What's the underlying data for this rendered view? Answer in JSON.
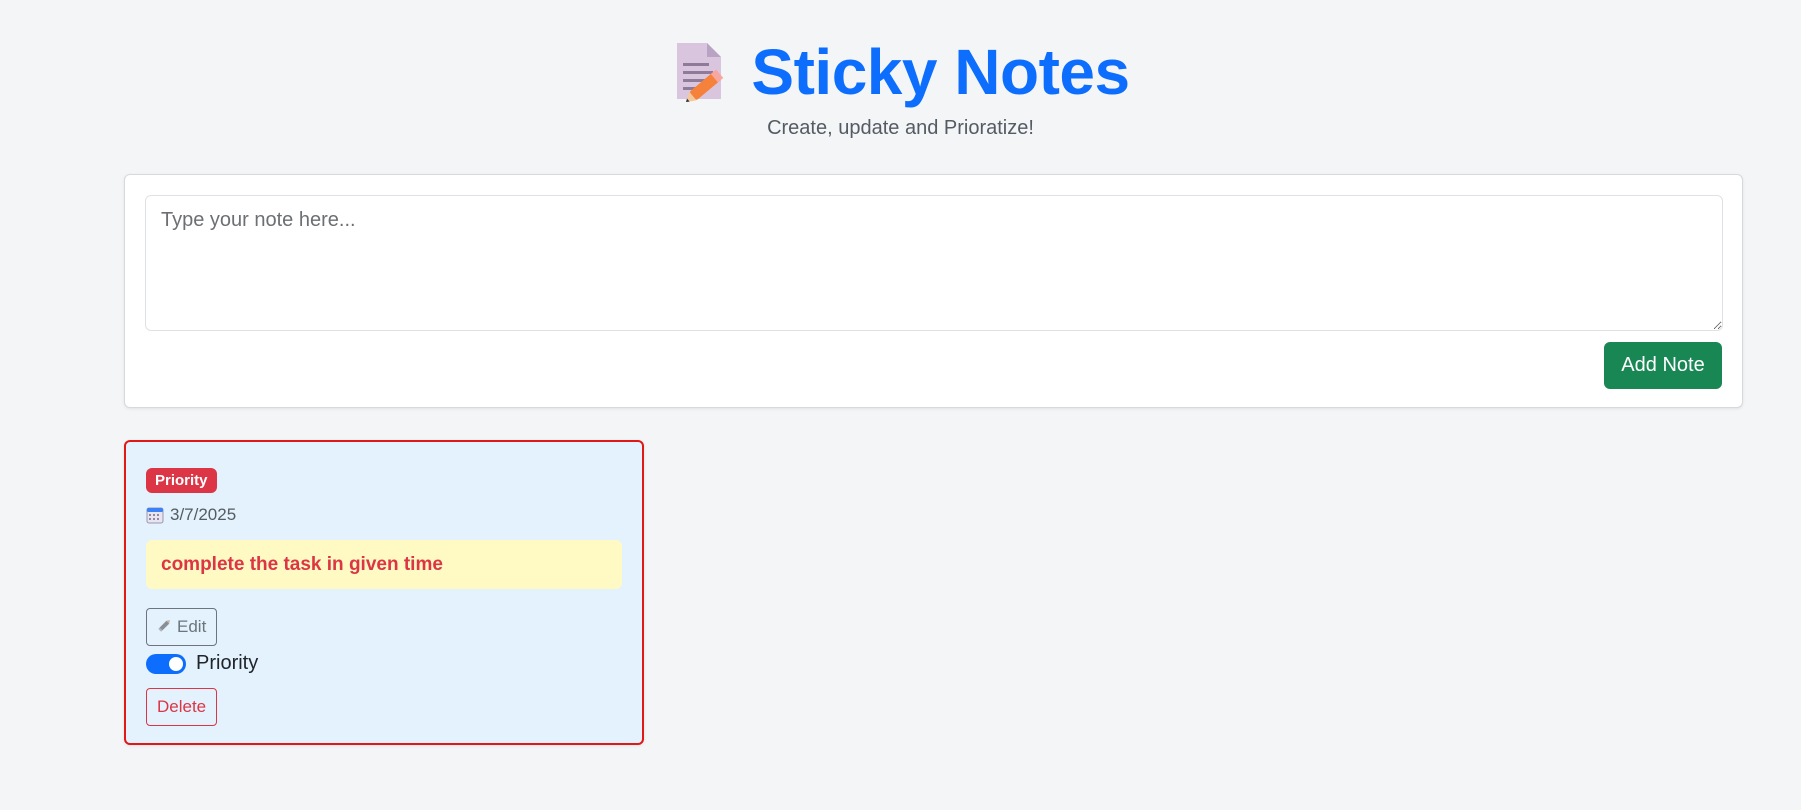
{
  "header": {
    "title": "Sticky Notes",
    "subtitle": "Create, update and Prioratize!",
    "title_icon": "memo-icon"
  },
  "composer": {
    "input_value": "",
    "input_placeholder": "Type your note here...",
    "add_label": "Add Note"
  },
  "notes": [
    {
      "badge": "Priority",
      "date": "3/7/2025",
      "text": "complete the task in given time",
      "edit_label": "Edit",
      "priority_toggle_label": "Priority",
      "priority_on": true,
      "delete_label": "Delete"
    }
  ],
  "colors": {
    "accent": "#0d6efd",
    "add_button": "#198754",
    "priority": "#dc3545",
    "card_border": "#e01818",
    "card_bg": "#e3f2fd",
    "note_bg": "#fff9c4",
    "page_bg": "#f3f5f7"
  }
}
